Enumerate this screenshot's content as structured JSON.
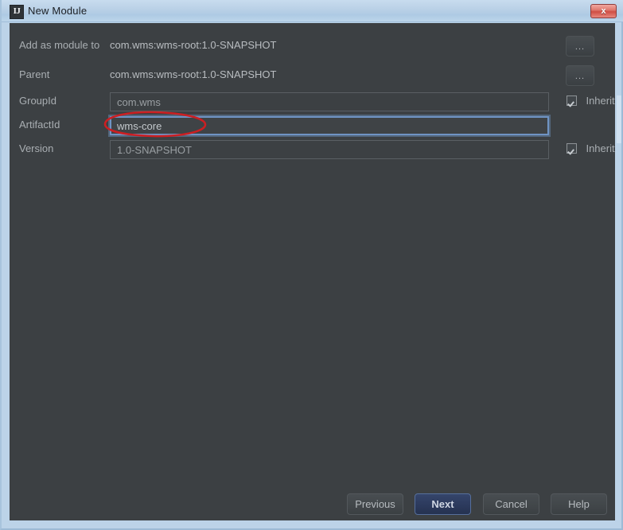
{
  "window": {
    "title": "New Module",
    "app_icon": "intellij-idea-icon",
    "app_icon_text": "IJ",
    "close_label": "x",
    "frame_color": "#bcd3e8",
    "content_bg": "#3c4043"
  },
  "form": {
    "rows": [
      {
        "name": "add-as-module-to",
        "label": "Add as module to",
        "value": "com.wms:wms-root:1.0-SNAPSHOT",
        "control": "static",
        "trailing": "browse",
        "browse_label": "..."
      },
      {
        "name": "parent",
        "label": "Parent",
        "value": "com.wms:wms-root:1.0-SNAPSHOT",
        "control": "static",
        "trailing": "browse",
        "browse_label": "..."
      },
      {
        "name": "group-id",
        "label": "GroupId",
        "value": "com.wms",
        "control": "input",
        "focused": false,
        "trailing": "inherit",
        "inherit_label": "Inherit",
        "inherit_checked": true
      },
      {
        "name": "artifact-id",
        "label": "ArtifactId",
        "value": "wms-core",
        "control": "input",
        "focused": true,
        "trailing": "none"
      },
      {
        "name": "version",
        "label": "Version",
        "value": "1.0-SNAPSHOT",
        "control": "input",
        "focused": false,
        "trailing": "inherit",
        "inherit_label": "Inherit",
        "inherit_checked": true
      }
    ]
  },
  "annotation": {
    "type": "hand-drawn-ellipse",
    "color": "#cc1f22",
    "target": "artifact-id-field"
  },
  "footer": {
    "buttons": [
      {
        "name": "previous-button",
        "label": "Previous",
        "default": false
      },
      {
        "name": "next-button",
        "label": "Next",
        "default": true
      },
      {
        "name": "cancel-button",
        "label": "Cancel",
        "default": false
      },
      {
        "name": "help-button",
        "label": "Help",
        "default": false
      }
    ]
  }
}
